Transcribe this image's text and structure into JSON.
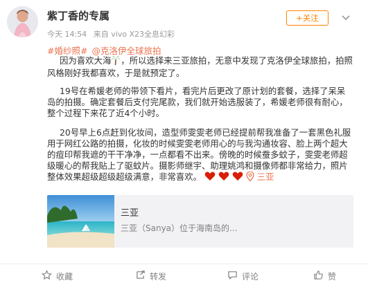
{
  "user": {
    "name": "紫丁香的专属",
    "time": "今天 14:54",
    "source": "来自 vivo X23全息幻彩",
    "follow_label": "+关注"
  },
  "topics": [
    "#婚纱照#",
    "@克洛伊全球旅拍"
  ],
  "post": {
    "p1a": "因为喜欢大海",
    "p1b": "，所以选择来三亚旅拍，无意中发现了克洛伊全球旅拍，拍照风格刚好我都喜欢，于是就预定了。",
    "p2": "19号在希媛老师的带领下看片，看完片后更改了原计划的套餐，选择了呆呆岛的拍摄。确定套餐后支付完尾款，我们就开始选服装了，希媛老师很有耐心，整个过程下来花了近4个小时。",
    "p3": "20号早上6点赶到化妆间，造型师雯雯老师已经提前帮我准备了一套黑色礼服用于网红公路的拍摄，化妆的时候雯雯老师用心的与我沟通妆容、脸上两个超大的痘印帮我遮的干干净净，一点都看不出来。傍晚的时候蚕多蚊子，雯雯老师超级暖心的帮我贴上了驱蚊片。摄影师继宇、助理姚鸿和摄像师都非常给力，照片整体效果超级超级超级满意，非常喜欢。",
    "location": "三亚"
  },
  "card": {
    "title": "三亚",
    "description": "三亚（Sanya）位于海南岛的..."
  },
  "actions": {
    "favorite": "收藏",
    "share": "转发",
    "comment": "评论",
    "like": "赞"
  },
  "icons": {
    "avatar": "avatar",
    "more": "chevron-down-icon",
    "palm": "palm-tree-icon",
    "heart": "red-heart-icon",
    "location": "location-pin-icon",
    "favorite": "star-icon",
    "share": "share-icon",
    "comment": "comment-icon",
    "like": "thumbs-up-icon"
  },
  "colors": {
    "accent": "#ff8200",
    "link": "#eb7350",
    "heart": "#d81e06",
    "palm": "#4caf50",
    "text": "#333333",
    "muted": "#808080"
  }
}
